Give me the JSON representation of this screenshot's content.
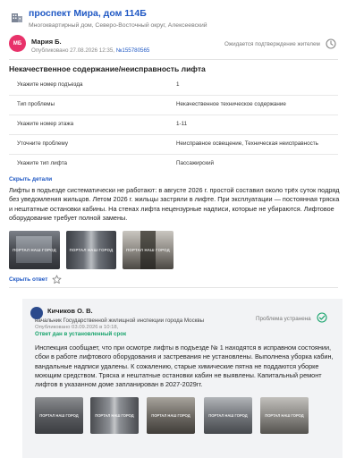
{
  "header": {
    "address": "проспект Мира, дом 114Б",
    "subtitle": "Многоквартирный дом, Северо-Восточный округ, Алексеевский"
  },
  "author": {
    "initials": "МБ",
    "name": "Мария Б.",
    "published_prefix": "Опубликовано 27.08.2026 12:35,",
    "number": "№155780565",
    "status": "Ожидается подтверждение жителем"
  },
  "problem": {
    "title": "Некачественное содержание/неисправность лифта",
    "rows": [
      {
        "key": "Укажите номер подъезда",
        "value": "1"
      },
      {
        "key": "Тип проблемы",
        "value": "Некачественное техническое содержание"
      },
      {
        "key": "Укажите номер этажа",
        "value": "1-11"
      },
      {
        "key": "Уточните проблему",
        "value": "Неисправное освещение, Техническая неисправность"
      },
      {
        "key": "Укажите тип лифта",
        "value": "Пассажирский"
      }
    ],
    "hide_details": "Скрыть детали",
    "description": "Лифты в подъезде систематически не работают: в августе 2026 г. простой составил около трёх суток подряд без уведомления жильцов. Летом 2026 г. жильцы застряли в лифте. При эксплуатации — постоянная тряска и нештатные остановки кабины. На стенах лифта нецензурные надписи, которые не убираются. Лифтовое оборудование требует полной замены.",
    "watermark": "ПОРТАЛ НАШ ГОРОД",
    "hide_answer": "Скрыть ответ"
  },
  "answer": {
    "name": "Кичиков О. В.",
    "role": "начальник Государственной жилищной инспекции города Москвы",
    "date": "Опубликовано 03.09.2026 в 10:18,",
    "on_time": "Ответ дан в установленный срок",
    "status": "Проблема устранена",
    "text": "Инспекция сообщает, что при осмотре лифты в подъезде № 1 находятся в исправном состоянии, сбои в работе лифтового оборудования и застревания не установлены. Выполнена уборка кабин, вандальные надписи удалены. К сожалению, старые химические пятна не поддаются уборке моющим средством. Тряска и нештатные остановки кабин не выявлены. Капитальный ремонт лифтов в указанном доме запланирован в 2027-2029гг.",
    "watermark": "ПОРТАЛ НАШ ГОРОД"
  },
  "colors": {
    "link": "#1f58c4",
    "avatar": "#e8326a",
    "success": "#16a36b",
    "answer_bg": "#f2f3f5"
  },
  "icons": [
    "building-icon",
    "clock-icon",
    "star-icon",
    "check-icon"
  ]
}
